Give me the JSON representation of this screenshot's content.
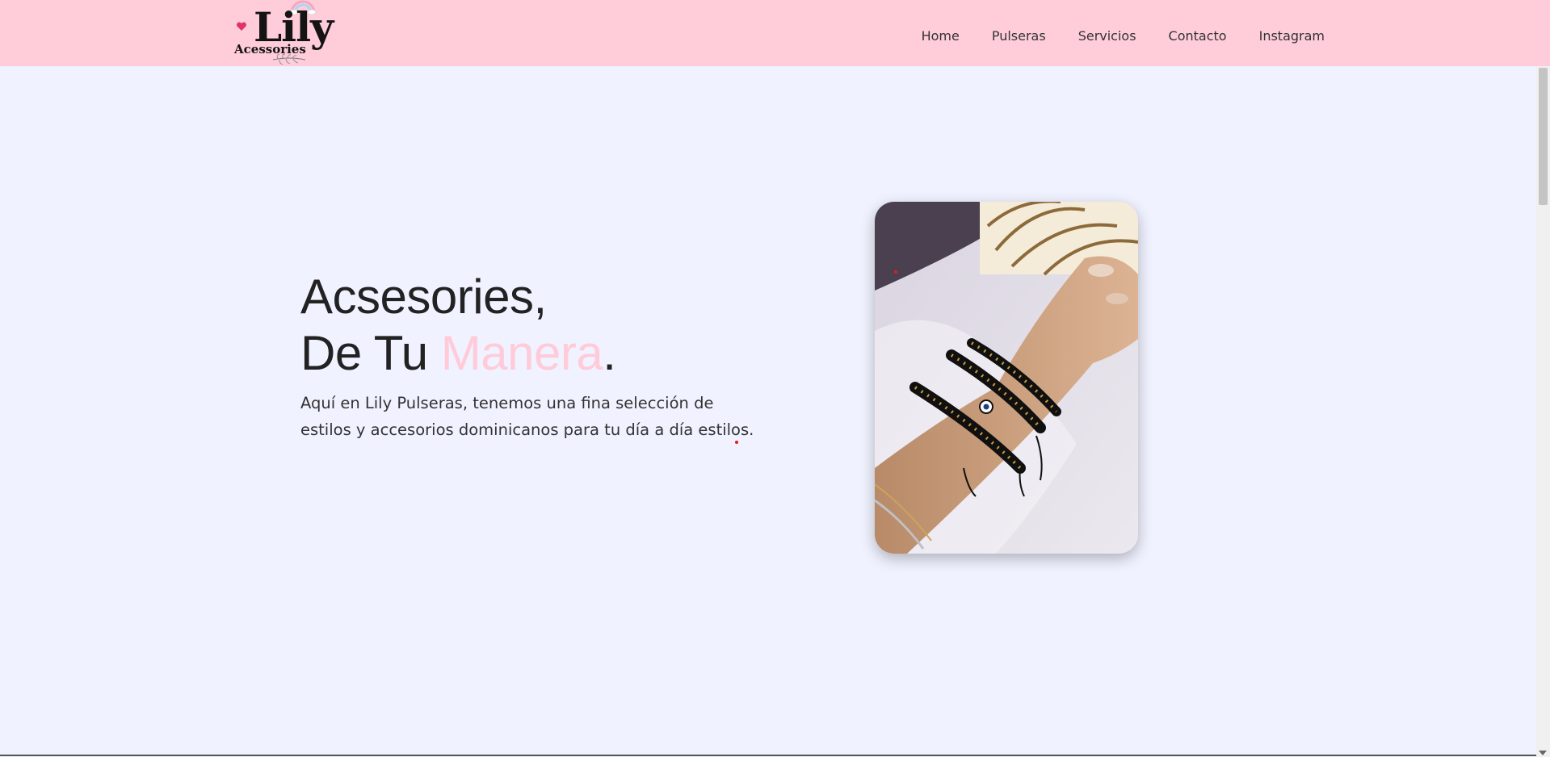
{
  "brand": {
    "name": "Lily",
    "subtitle": "Acessories"
  },
  "nav": {
    "items": [
      {
        "label": "Home"
      },
      {
        "label": "Pulseras"
      },
      {
        "label": "Servicios"
      },
      {
        "label": "Contacto"
      },
      {
        "label": "Instagram"
      }
    ]
  },
  "hero": {
    "title_line1": "Acsesories,",
    "title_line2_prefix": "De Tu ",
    "title_line2_accent": "Manera",
    "title_line2_suffix": ".",
    "description": "Aquí en Lily Pulseras, tenemos una fina selección de estilos y accesorios dominicanos para tu día a día estilos."
  },
  "colors": {
    "navbar_background": "#ffcdd9",
    "page_background": "#f0f2ff",
    "accent": "#ffcbd8",
    "text": "#222222"
  },
  "icons": {
    "logo_heart": "heart-icon",
    "logo_rainbow": "rainbow-icon",
    "logo_sprig": "leaf-sprig-icon",
    "scroll_down": "chevron-down-icon"
  }
}
